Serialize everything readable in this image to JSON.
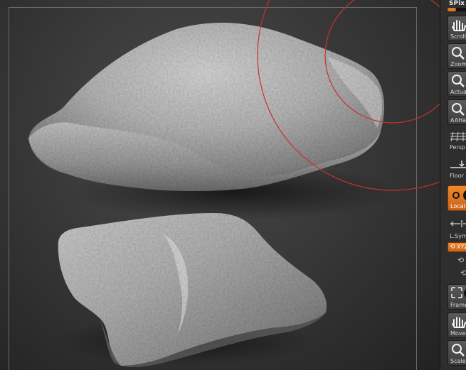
{
  "shelf": {
    "title": "SPix",
    "spix_level": 0.3,
    "accent_color": "#e07a1e",
    "buttons": [
      {
        "label": "Scroll",
        "icon": "hand-icon",
        "active": false
      },
      {
        "label": "Zoom",
        "icon": "zoom-icon",
        "active": false
      },
      {
        "label": "Actual",
        "icon": "actual-size-icon",
        "active": false
      },
      {
        "label": "AAHalf",
        "icon": "aahalf-icon",
        "active": false
      },
      {
        "label": "Persp",
        "icon": "perspective-icon",
        "active": false
      },
      {
        "label": "Floor",
        "icon": "floor-icon",
        "active": false
      },
      {
        "label": "Local",
        "icon": "local-icon",
        "active": true
      },
      {
        "label": "L.Sym",
        "icon": "local-symmetry-icon",
        "active": false
      },
      {
        "label": "XYZ",
        "icon": "xyz-rotate-icon",
        "active": true
      },
      {
        "label": "Frame",
        "icon": "frame-icon",
        "active": false
      },
      {
        "label": "Move",
        "icon": "move-icon",
        "active": false
      },
      {
        "label": "Scale",
        "icon": "scale-icon",
        "active": false
      }
    ]
  },
  "viewport": {
    "brush_cursor_color": "#c8322c"
  }
}
